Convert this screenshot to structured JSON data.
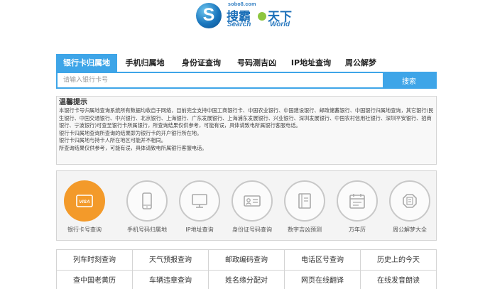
{
  "logo": {
    "domain": "sobo8.com",
    "cn1": "搜霸",
    "cn2": "天下",
    "en1": "Search",
    "en2": "World",
    "mark": "S"
  },
  "tabs": [
    {
      "label": "银行卡归属地",
      "active": true
    },
    {
      "label": "手机归属地",
      "active": false
    },
    {
      "label": "身份证查询",
      "active": false
    },
    {
      "label": "号码测吉凶",
      "active": false
    },
    {
      "label": "IP地址查询",
      "active": false
    },
    {
      "label": "周公解梦",
      "active": false
    }
  ],
  "search": {
    "placeholder": "请输入银行卡号",
    "button": "搜索"
  },
  "tips": {
    "title": "温馨提示",
    "line1": "本银行卡号归属地查询系统所有数据均收自于网络，目前完全支持中国工商银行卡、中国农业银行、中国建设银行、邮政储蓄银行、中国银行归属地查询，其它银行(民生银行、中国交通银行、中兴银行、北京银行、上海银行、广东发展银行、上海浦东发展银行、兴业银行、深圳发展银行、中国农村信用社银行、深圳平安银行、招商银行、宁波银行)可查至银行卡所属银行，所查询结果仅供参考，可能有误，具体请致电所属银行客服电话。",
    "line2": "银行卡归属地查询所查询的结果即为银行卡的开户银行所在地。",
    "line3": "银行卡归属地与持卡人所在地区可能并不相同。",
    "line4": "所查询结果仅供参考，可能有误，具体请致电所属银行客服电话。"
  },
  "icons": [
    {
      "label": "银行卡号查询",
      "icon": "visa-card-icon",
      "active": true
    },
    {
      "label": "手机号码归属地",
      "icon": "mobile-phone-icon",
      "active": false
    },
    {
      "label": "IP地址查询",
      "icon": "computer-monitor-icon",
      "active": false
    },
    {
      "label": "身份证号码查询",
      "icon": "id-card-icon",
      "active": false
    },
    {
      "label": "数字吉凶预测",
      "icon": "book-icon",
      "active": false
    },
    {
      "label": "万年历",
      "icon": "calendar-icon",
      "active": false
    },
    {
      "label": "周公解梦大全",
      "icon": "moon-dream-icon",
      "active": false
    }
  ],
  "icon_text": {
    "visa": "VISA"
  },
  "links": [
    [
      "列车时刻查询",
      "天气预报查询",
      "邮政编码查询",
      "电话区号查询",
      "历史上的今天"
    ],
    [
      "查中国老黄历",
      "车辆违章查询",
      "姓名缘分配对",
      "网页在线翻译",
      "在线发音朗读"
    ]
  ],
  "colors": {
    "accent": "#3ea5e8",
    "active_icon": "#f39a2a",
    "logo_blue": "#1b6fb8",
    "logo_green": "#8dc63f"
  }
}
